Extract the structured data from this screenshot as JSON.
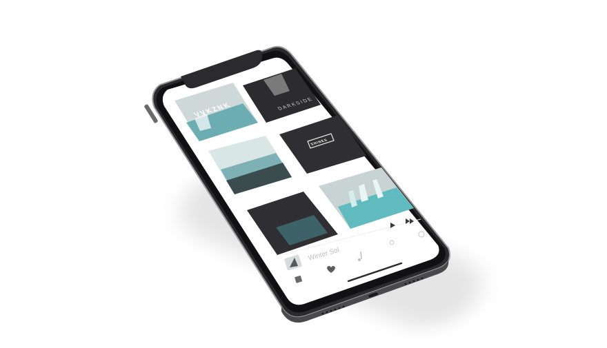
{
  "now_playing": {
    "track_title": "Winter Sol",
    "controls": [
      "play-icon",
      "fast-forward-icon"
    ]
  },
  "tiles": [
    {
      "art_text": "VVKZNK",
      "palette": [
        "#cfd8d8",
        "#5aa6ad"
      ]
    },
    {
      "art_text": "DARKSIDE",
      "palette": [
        "#2c2c2e",
        "#bcbcbc"
      ]
    },
    {
      "art_text": "",
      "palette": [
        "#d9e6e6",
        "#65a4aa"
      ]
    },
    {
      "art_text": "SHINES",
      "palette": [
        "#2f2f33",
        "#6e6e73"
      ]
    },
    {
      "art_text": "",
      "palette": [
        "#2e2e33",
        "#4a8f96"
      ]
    },
    {
      "art_text": "",
      "palette": [
        "#c8d3d3",
        "#4cb6b8"
      ]
    }
  ],
  "tab_bar": {
    "icons": [
      "artist-avatar",
      "heart-icon",
      "music-note-icon"
    ]
  },
  "colors": {
    "body": "#3a3a3c",
    "screen": "#ffffff",
    "accent": "#59b4b8"
  }
}
